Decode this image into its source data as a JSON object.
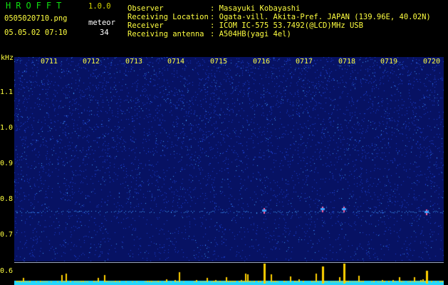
{
  "header": {
    "app_title": "HROFFT",
    "version": "1.0.0",
    "filename": "0505020710.png",
    "datetime": "05.05.02 07:10",
    "mode_label": "meteor",
    "meteor_count": "34",
    "info": [
      {
        "key": "Observer",
        "value": ": Masayuki Kobayashi"
      },
      {
        "key": "Receiving Location",
        "value": ": Ogata-vill. Akita-Pref. JAPAN (139.96E, 40.02N)"
      },
      {
        "key": "Receiver",
        "value": ": ICOM IC-575 53.7492(@LCD)MHz USB"
      },
      {
        "key": "Receiving antenna",
        "value": ": A504HB(yagi 4el)"
      }
    ]
  },
  "spectrogram": {
    "unit": "kHz",
    "freq_ticks": [
      "1.1",
      "1.0",
      "0.9",
      "0.8",
      "0.7"
    ],
    "lower_freq_tick": "0.6",
    "time_ticks": [
      "0711",
      "0712",
      "0713",
      "0714",
      "0715",
      "0716",
      "0717",
      "0718",
      "0719",
      "0720"
    ],
    "colors": {
      "background": "#071263",
      "noise_low": "#1a3fd0",
      "noise_high": "#3fa0ff",
      "echo": "#ff60a0",
      "meteor_bars": "#ffd000",
      "baseline": "#22d8ff"
    }
  }
}
